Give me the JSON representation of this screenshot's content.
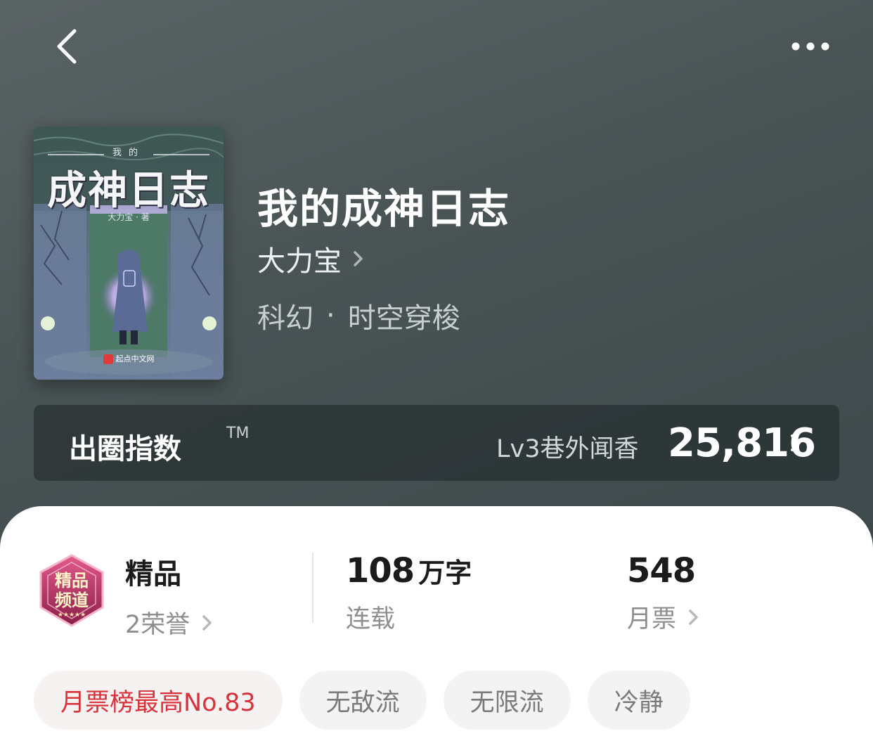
{
  "nav": {
    "back_icon": "chevron-left-icon",
    "more_icon": "more-dots-icon"
  },
  "cover": {
    "small_title": "我的",
    "title": "成神日志",
    "author": "大力宝 · 著",
    "publisher": "起点中文网"
  },
  "book": {
    "title": "我的成神日志",
    "author": "大力宝",
    "category": "科幻",
    "subcategory": "时空穿梭",
    "separator": "·"
  },
  "index_bar": {
    "label": "出圈指数",
    "tm": "TM",
    "level": "Lv3巷外闻香",
    "value": "25,816"
  },
  "stats": {
    "quality": {
      "title": "精品",
      "honors": "2荣誉",
      "badge_text_1": "精品",
      "badge_text_2": "频道"
    },
    "words": {
      "number": "108",
      "unit": "万字",
      "status": "连载"
    },
    "tickets": {
      "number": "548",
      "label": "月票"
    }
  },
  "tags": [
    "月票榜最高No.83",
    "无敌流",
    "无限流",
    "冷静"
  ],
  "colors": {
    "accent_red": "#d8323a",
    "header_bg": "#4a5455",
    "card_bg": "#ffffff"
  }
}
